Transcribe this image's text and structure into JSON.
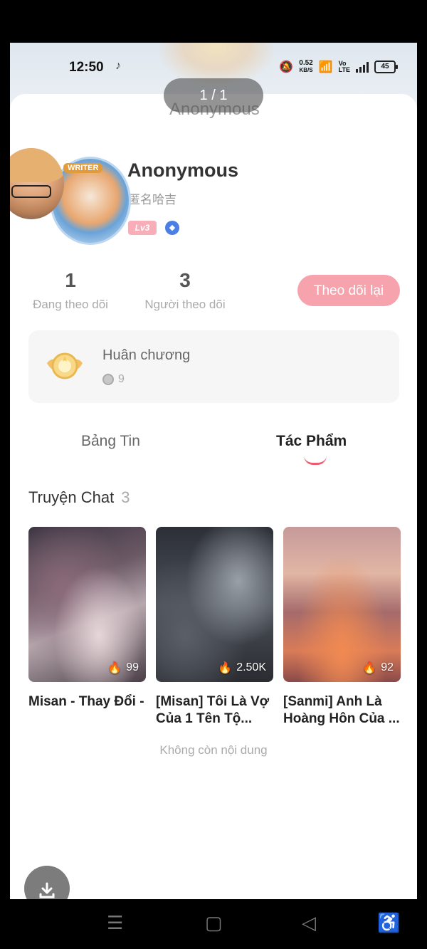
{
  "status_bar": {
    "time": "12:50",
    "net_speed_value": "0.52",
    "net_speed_unit": "KB/S",
    "battery": "45",
    "icons": [
      "tiktok-icon",
      "mute-icon",
      "wifi-icon",
      "volte-icon",
      "signal-icon",
      "battery-icon"
    ]
  },
  "viewer": {
    "page_indicator": "1 / 1",
    "ghost_title": "Anonymous"
  },
  "profile": {
    "name": "Anonymous",
    "subname": "匿名哈吉",
    "level": "Lv3",
    "avatar_badge": "WRITER",
    "following_count": "1",
    "following_label": "Đang theo dõi",
    "followers_count": "3",
    "followers_label": "Người theo dõi",
    "follow_button": "Theo dõi lại"
  },
  "medals": {
    "title": "Huân chương",
    "count": "9"
  },
  "tabs": [
    {
      "label": "Bảng Tin",
      "active": false
    },
    {
      "label": "Tác Phẩm",
      "active": true
    }
  ],
  "section": {
    "title": "Truyện Chat",
    "count": "3"
  },
  "stories": [
    {
      "title": "Misan - Thay Đổi -",
      "likes": "99"
    },
    {
      "title": "[Misan] Tôi Là Vợ Của 1 Tên Tộ...",
      "likes": "2.50K"
    },
    {
      "title": "[Sanmi] Anh Là Hoàng Hôn Của ...",
      "likes": "92"
    }
  ],
  "end_text": "Không còn nội dung",
  "colors": {
    "accent_pink": "#f6a3ae",
    "tab_indicator": "#ef5a6f",
    "level_badge": "#f7aeb8"
  }
}
